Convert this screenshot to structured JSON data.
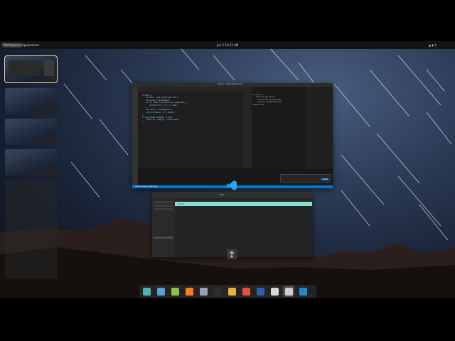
{
  "topbar": {
    "workspaces_label": "Workspaces",
    "applications_label": "Applications",
    "clock": "Jun 5  10:33 AM"
  },
  "workspaces": {
    "count": 5,
    "active_index": 0
  },
  "code_window": {
    "title": "main.rs - Visual Studio Code",
    "code_lines": [
      "fn main() {",
      "    let data = read_input(\"input.txt\");",
      "    let parsed = parse(&data);",
      "",
      "    for (i, item) in parsed.iter().enumerate() {",
      "        println!(\"{}: {:?}\", i, item);",
      "    }",
      "",
      "    let result = solve(&parsed);",
      "    println!(\"Result: {}\", result);",
      "}",
      "",
      "fn solve(items: &[Item]) -> u64 {",
      "    items.iter().map(|x| x.value).sum()",
      "}"
    ],
    "terminal_lines": [
      "$ cargo run",
      "   Compiling app v0.1.0",
      "    Finished dev [unoptimized]",
      "     Running `target/debug/app`",
      "Result: 4821"
    ],
    "status_bar": "main  0 errors  0 warnings",
    "notification_button": "Install"
  },
  "file_window": {
    "title": "Files",
    "path_label": "Home"
  },
  "dock": {
    "apps": [
      {
        "name": "workspace-switcher-icon",
        "color": "#4fb3b3"
      },
      {
        "name": "save-icon",
        "color": "#5aa0d8"
      },
      {
        "name": "app-grid-icon",
        "color": "#8bc34a"
      },
      {
        "name": "firefox-icon",
        "color": "#ff7a1a"
      },
      {
        "name": "files-icon",
        "color": "#9aa3ad"
      },
      {
        "name": "terminal-icon",
        "color": "#2e2e2e"
      },
      {
        "name": "archive-icon",
        "color": "#e3b341"
      },
      {
        "name": "brave-icon",
        "color": "#e0533d"
      },
      {
        "name": "kdenlive-icon",
        "color": "#2b5fab"
      },
      {
        "name": "clock-icon",
        "color": "#d9d9d9"
      },
      {
        "name": "usb-icon",
        "color": "#cfcfcf"
      },
      {
        "name": "vscode-icon",
        "color": "#1f8ad2"
      }
    ],
    "active_index": 10
  }
}
